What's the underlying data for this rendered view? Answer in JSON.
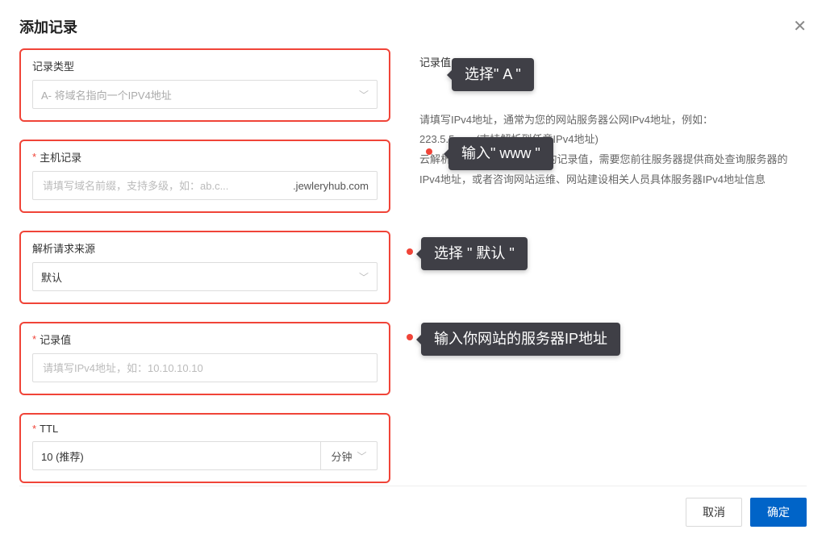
{
  "title": "添加记录",
  "fields": {
    "type": {
      "label": "记录类型",
      "value": "A- 将域名指向一个IPV4地址"
    },
    "host": {
      "label": "主机记录",
      "placeholder": "请填写域名前缀，支持多级，如：ab.c...",
      "suffix": ".jewleryhub.com"
    },
    "source": {
      "label": "解析请求来源",
      "value": "默认"
    },
    "value": {
      "label": "记录值",
      "placeholder": "请填写IPv4地址，如：10.10.10.10"
    },
    "ttl": {
      "label": "TTL",
      "value": "10 (推荐)",
      "unit": "分钟"
    }
  },
  "help": {
    "title": "记录值",
    "line1": "请填写IPv4地址，通常为您的网站服务器公网IPv4地址，例如：",
    "line2": "223.5.5.x 。(支持解析到任意IPv4地址)",
    "line3": "云解析DNS产品无法知晓您的记录值，需要您前往服务器提供商处查询服务器的IPv4地址，或者咨询网站运维、网站建设相关人员具体服务器IPv4地址信息"
  },
  "annotations": {
    "b1": "选择\" A \"",
    "b2": "输入\" www \"",
    "b3": "选择 \" 默认 \"",
    "b4": "输入你网站的服务器IP地址"
  },
  "buttons": {
    "cancel": "取消",
    "confirm": "确定"
  }
}
